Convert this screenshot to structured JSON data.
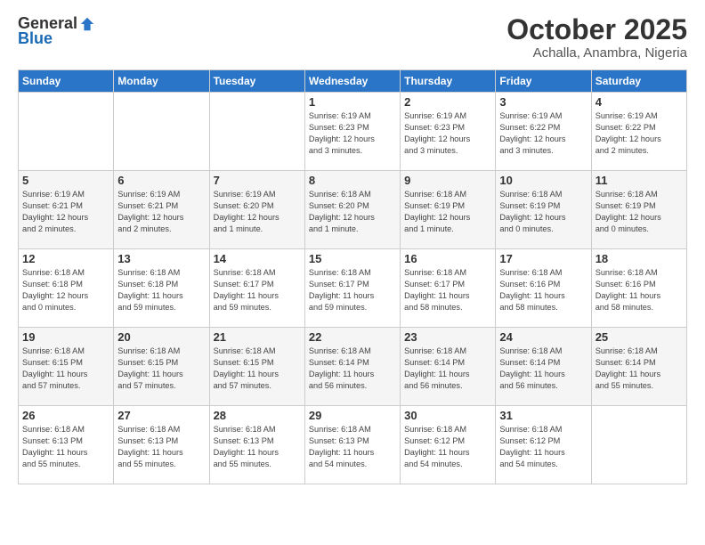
{
  "logo": {
    "general": "General",
    "blue": "Blue"
  },
  "title": "October 2025",
  "subtitle": "Achalla, Anambra, Nigeria",
  "days_of_week": [
    "Sunday",
    "Monday",
    "Tuesday",
    "Wednesday",
    "Thursday",
    "Friday",
    "Saturday"
  ],
  "weeks": [
    [
      {
        "day": "",
        "info": ""
      },
      {
        "day": "",
        "info": ""
      },
      {
        "day": "",
        "info": ""
      },
      {
        "day": "1",
        "info": "Sunrise: 6:19 AM\nSunset: 6:23 PM\nDaylight: 12 hours\nand 3 minutes."
      },
      {
        "day": "2",
        "info": "Sunrise: 6:19 AM\nSunset: 6:23 PM\nDaylight: 12 hours\nand 3 minutes."
      },
      {
        "day": "3",
        "info": "Sunrise: 6:19 AM\nSunset: 6:22 PM\nDaylight: 12 hours\nand 3 minutes."
      },
      {
        "day": "4",
        "info": "Sunrise: 6:19 AM\nSunset: 6:22 PM\nDaylight: 12 hours\nand 2 minutes."
      }
    ],
    [
      {
        "day": "5",
        "info": "Sunrise: 6:19 AM\nSunset: 6:21 PM\nDaylight: 12 hours\nand 2 minutes."
      },
      {
        "day": "6",
        "info": "Sunrise: 6:19 AM\nSunset: 6:21 PM\nDaylight: 12 hours\nand 2 minutes."
      },
      {
        "day": "7",
        "info": "Sunrise: 6:19 AM\nSunset: 6:20 PM\nDaylight: 12 hours\nand 1 minute."
      },
      {
        "day": "8",
        "info": "Sunrise: 6:18 AM\nSunset: 6:20 PM\nDaylight: 12 hours\nand 1 minute."
      },
      {
        "day": "9",
        "info": "Sunrise: 6:18 AM\nSunset: 6:19 PM\nDaylight: 12 hours\nand 1 minute."
      },
      {
        "day": "10",
        "info": "Sunrise: 6:18 AM\nSunset: 6:19 PM\nDaylight: 12 hours\nand 0 minutes."
      },
      {
        "day": "11",
        "info": "Sunrise: 6:18 AM\nSunset: 6:19 PM\nDaylight: 12 hours\nand 0 minutes."
      }
    ],
    [
      {
        "day": "12",
        "info": "Sunrise: 6:18 AM\nSunset: 6:18 PM\nDaylight: 12 hours\nand 0 minutes."
      },
      {
        "day": "13",
        "info": "Sunrise: 6:18 AM\nSunset: 6:18 PM\nDaylight: 11 hours\nand 59 minutes."
      },
      {
        "day": "14",
        "info": "Sunrise: 6:18 AM\nSunset: 6:17 PM\nDaylight: 11 hours\nand 59 minutes."
      },
      {
        "day": "15",
        "info": "Sunrise: 6:18 AM\nSunset: 6:17 PM\nDaylight: 11 hours\nand 59 minutes."
      },
      {
        "day": "16",
        "info": "Sunrise: 6:18 AM\nSunset: 6:17 PM\nDaylight: 11 hours\nand 58 minutes."
      },
      {
        "day": "17",
        "info": "Sunrise: 6:18 AM\nSunset: 6:16 PM\nDaylight: 11 hours\nand 58 minutes."
      },
      {
        "day": "18",
        "info": "Sunrise: 6:18 AM\nSunset: 6:16 PM\nDaylight: 11 hours\nand 58 minutes."
      }
    ],
    [
      {
        "day": "19",
        "info": "Sunrise: 6:18 AM\nSunset: 6:15 PM\nDaylight: 11 hours\nand 57 minutes."
      },
      {
        "day": "20",
        "info": "Sunrise: 6:18 AM\nSunset: 6:15 PM\nDaylight: 11 hours\nand 57 minutes."
      },
      {
        "day": "21",
        "info": "Sunrise: 6:18 AM\nSunset: 6:15 PM\nDaylight: 11 hours\nand 57 minutes."
      },
      {
        "day": "22",
        "info": "Sunrise: 6:18 AM\nSunset: 6:14 PM\nDaylight: 11 hours\nand 56 minutes."
      },
      {
        "day": "23",
        "info": "Sunrise: 6:18 AM\nSunset: 6:14 PM\nDaylight: 11 hours\nand 56 minutes."
      },
      {
        "day": "24",
        "info": "Sunrise: 6:18 AM\nSunset: 6:14 PM\nDaylight: 11 hours\nand 56 minutes."
      },
      {
        "day": "25",
        "info": "Sunrise: 6:18 AM\nSunset: 6:14 PM\nDaylight: 11 hours\nand 55 minutes."
      }
    ],
    [
      {
        "day": "26",
        "info": "Sunrise: 6:18 AM\nSunset: 6:13 PM\nDaylight: 11 hours\nand 55 minutes."
      },
      {
        "day": "27",
        "info": "Sunrise: 6:18 AM\nSunset: 6:13 PM\nDaylight: 11 hours\nand 55 minutes."
      },
      {
        "day": "28",
        "info": "Sunrise: 6:18 AM\nSunset: 6:13 PM\nDaylight: 11 hours\nand 55 minutes."
      },
      {
        "day": "29",
        "info": "Sunrise: 6:18 AM\nSunset: 6:13 PM\nDaylight: 11 hours\nand 54 minutes."
      },
      {
        "day": "30",
        "info": "Sunrise: 6:18 AM\nSunset: 6:12 PM\nDaylight: 11 hours\nand 54 minutes."
      },
      {
        "day": "31",
        "info": "Sunrise: 6:18 AM\nSunset: 6:12 PM\nDaylight: 11 hours\nand 54 minutes."
      },
      {
        "day": "",
        "info": ""
      }
    ]
  ]
}
